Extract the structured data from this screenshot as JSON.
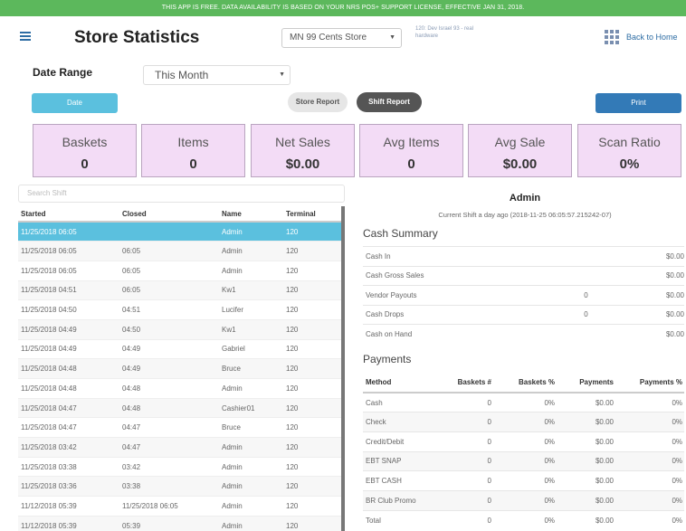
{
  "banner": "THIS APP IS FREE. DATA AVAILABILITY IS BASED ON YOUR NRS POS+ SUPPORT LICENSE, EFFECTIVE JAN 31, 2018.",
  "header": {
    "title": "Store Statistics",
    "store": "MN 99 Cents Store",
    "register_line1": "120: Dev Israel 93 - real",
    "register_line2": "hardware",
    "back_home": "Back to Home"
  },
  "filters": {
    "date_range_label": "Date Range",
    "date_range_value": "This Month",
    "date_button": "Date",
    "store_report": "Store Report",
    "shift_report": "Shift Report",
    "print": "Print"
  },
  "stats": [
    {
      "label": "Baskets",
      "value": "0"
    },
    {
      "label": "Items",
      "value": "0"
    },
    {
      "label": "Net Sales",
      "value": "$0.00"
    },
    {
      "label": "Avg Items",
      "value": "0"
    },
    {
      "label": "Avg Sale",
      "value": "$0.00"
    },
    {
      "label": "Scan Ratio",
      "value": "0%"
    }
  ],
  "shift_table": {
    "search_placeholder": "Search Shift",
    "columns": [
      "Started",
      "Closed",
      "Name",
      "Terminal"
    ],
    "rows": [
      [
        "11/25/2018 06:05",
        "",
        "Admin",
        "120"
      ],
      [
        "11/25/2018 06:05",
        "06:05",
        "Admin",
        "120"
      ],
      [
        "11/25/2018 06:05",
        "06:05",
        "Admin",
        "120"
      ],
      [
        "11/25/2018 04:51",
        "06:05",
        "Kw1",
        "120"
      ],
      [
        "11/25/2018 04:50",
        "04:51",
        "Lucifer",
        "120"
      ],
      [
        "11/25/2018 04:49",
        "04:50",
        "Kw1",
        "120"
      ],
      [
        "11/25/2018 04:49",
        "04:49",
        "Gabriel",
        "120"
      ],
      [
        "11/25/2018 04:48",
        "04:49",
        "Bruce",
        "120"
      ],
      [
        "11/25/2018 04:48",
        "04:48",
        "Admin",
        "120"
      ],
      [
        "11/25/2018 04:47",
        "04:48",
        "Cashier01",
        "120"
      ],
      [
        "11/25/2018 04:47",
        "04:47",
        "Bruce",
        "120"
      ],
      [
        "11/25/2018 03:42",
        "04:47",
        "Admin",
        "120"
      ],
      [
        "11/25/2018 03:38",
        "03:42",
        "Admin",
        "120"
      ],
      [
        "11/25/2018 03:36",
        "03:38",
        "Admin",
        "120"
      ],
      [
        "11/12/2018 05:39",
        "11/25/2018 06:05",
        "Admin",
        "120"
      ],
      [
        "11/12/2018 05:39",
        "05:39",
        "Admin",
        "120"
      ]
    ]
  },
  "detail": {
    "name": "Admin",
    "shift_info": "Current Shift a day ago (2018-11-25 06:05:57.215242-07)",
    "cash_summary_title": "Cash Summary",
    "cash_rows": [
      {
        "label": "Cash In",
        "count": "",
        "amount": "$0.00"
      },
      {
        "label": "Cash Gross Sales",
        "count": "",
        "amount": "$0.00"
      },
      {
        "label": "Vendor Payouts",
        "count": "0",
        "amount": "$0.00"
      },
      {
        "label": "Cash Drops",
        "count": "0",
        "amount": "$0.00"
      },
      {
        "label": "Cash on Hand",
        "count": "",
        "amount": "$0.00"
      }
    ],
    "payments_title": "Payments",
    "payment_columns": [
      "Method",
      "Baskets #",
      "Baskets %",
      "Payments",
      "Payments %"
    ],
    "payment_rows": [
      [
        "Cash",
        "0",
        "0%",
        "$0.00",
        "0%"
      ],
      [
        "Check",
        "0",
        "0%",
        "$0.00",
        "0%"
      ],
      [
        "Credit/Debit",
        "0",
        "0%",
        "$0.00",
        "0%"
      ],
      [
        "EBT SNAP",
        "0",
        "0%",
        "$0.00",
        "0%"
      ],
      [
        "EBT CASH",
        "0",
        "0%",
        "$0.00",
        "0%"
      ],
      [
        "BR Club Promo",
        "0",
        "0%",
        "$0.00",
        "0%"
      ],
      [
        "Total",
        "0",
        "0%",
        "$0.00",
        "0%"
      ]
    ]
  }
}
